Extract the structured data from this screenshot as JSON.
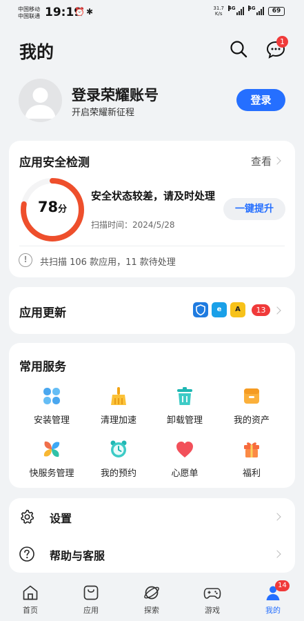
{
  "status_bar": {
    "carrier_1": "中国移动",
    "carrier_2": "中国联通",
    "time": "19:19",
    "net_speed_value": "31.7",
    "net_speed_unit": "K/s",
    "network_1": "4G",
    "network_2": "4G",
    "battery": "69"
  },
  "header": {
    "title": "我的",
    "message_badge": "1"
  },
  "profile": {
    "title": "登录荣耀账号",
    "subtitle": "开启荣耀新征程",
    "login_button": "登录"
  },
  "security": {
    "title": "应用安全检测",
    "view_link": "查看",
    "score": "78",
    "score_unit": "分",
    "score_fraction": 0.78,
    "status": "安全状态较差，请及时处理",
    "scan_time": "扫描时间：2024/5/28",
    "fix_button": "一键提升",
    "summary": "共扫描 106 款应用，11 款待处理"
  },
  "updates": {
    "title": "应用更新",
    "count": "13",
    "app_icons": [
      "shield-app-icon",
      "browser-app-icon",
      "yellow-app-icon"
    ]
  },
  "services": {
    "title": "常用服务",
    "items": [
      {
        "label": "安装管理",
        "icon": "install-manage-icon"
      },
      {
        "label": "清理加速",
        "icon": "broom-icon"
      },
      {
        "label": "卸载管理",
        "icon": "trash-icon"
      },
      {
        "label": "我的资产",
        "icon": "assets-box-icon"
      },
      {
        "label": "快服务管理",
        "icon": "pinwheel-icon"
      },
      {
        "label": "我的预约",
        "icon": "alarm-clock-icon"
      },
      {
        "label": "心愿单",
        "icon": "heart-icon"
      },
      {
        "label": "福利",
        "icon": "gift-icon"
      }
    ]
  },
  "settings": {
    "items": [
      {
        "label": "设置",
        "icon": "gear-icon"
      },
      {
        "label": "帮助与客服",
        "icon": "help-icon"
      }
    ]
  },
  "bottom_nav": {
    "items": [
      {
        "label": "首页",
        "icon": "home-icon"
      },
      {
        "label": "应用",
        "icon": "bag-icon"
      },
      {
        "label": "探索",
        "icon": "planet-icon"
      },
      {
        "label": "游戏",
        "icon": "gamepad-icon"
      },
      {
        "label": "我的",
        "icon": "profile-icon"
      }
    ],
    "active_index": 4,
    "profile_badge": "14"
  },
  "colors": {
    "accent": "#256fff",
    "danger": "#f03a3a",
    "score_ring": "#ee4f2c"
  }
}
